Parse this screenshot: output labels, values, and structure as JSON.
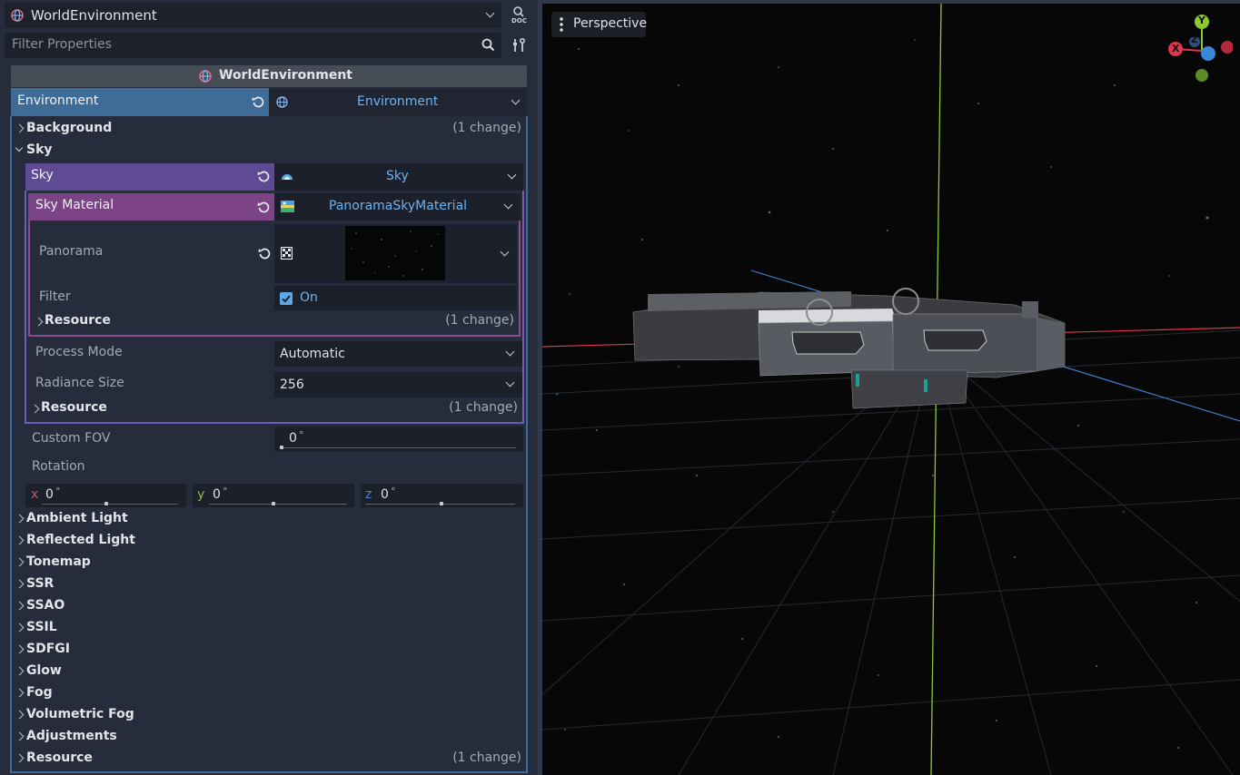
{
  "inspector": {
    "node_name": "WorldEnvironment",
    "filter_placeholder": "Filter Properties",
    "doc_label": "DOC",
    "section_title": "WorldEnvironment",
    "environment": {
      "label": "Environment",
      "resource": "Environment"
    },
    "groups_top": [
      {
        "label": "Background",
        "note": "(1 change)"
      }
    ],
    "sky_group": "Sky",
    "sky": {
      "label": "Sky",
      "resource": "Sky",
      "material_label": "Sky Material",
      "material_resource": "PanoramaSkyMaterial",
      "panorama_label": "Panorama",
      "filter_label": "Filter",
      "filter_value": "On",
      "mat_resource_label": "Resource",
      "mat_resource_note": "(1 change)",
      "process_mode_label": "Process Mode",
      "process_mode_value": "Automatic",
      "radiance_label": "Radiance Size",
      "radiance_value": "256",
      "sky_resource_label": "Resource",
      "sky_resource_note": "(1 change)"
    },
    "custom_fov": {
      "label": "Custom FOV",
      "value": "0",
      "unit": "°"
    },
    "rotation": {
      "label": "Rotation",
      "x": {
        "axis": "x",
        "value": "0",
        "unit": "°"
      },
      "y": {
        "axis": "y",
        "value": "0",
        "unit": "°"
      },
      "z": {
        "axis": "z",
        "value": "0",
        "unit": "°"
      }
    },
    "groups_bottom": [
      {
        "label": "Ambient Light",
        "note": ""
      },
      {
        "label": "Reflected Light",
        "note": ""
      },
      {
        "label": "Tonemap",
        "note": ""
      },
      {
        "label": "SSR",
        "note": ""
      },
      {
        "label": "SSAO",
        "note": ""
      },
      {
        "label": "SSIL",
        "note": ""
      },
      {
        "label": "SDFGI",
        "note": ""
      },
      {
        "label": "Glow",
        "note": ""
      },
      {
        "label": "Fog",
        "note": ""
      },
      {
        "label": "Volumetric Fog",
        "note": ""
      },
      {
        "label": "Adjustments",
        "note": ""
      },
      {
        "label": "Resource",
        "note": "(1 change)"
      }
    ]
  },
  "viewport": {
    "view_label": "Perspective",
    "gizmo": {
      "x": "X",
      "y": "Y",
      "z": "Z"
    }
  },
  "colors": {
    "accent": "#5fa8e8",
    "environment_header": "#3f6b97",
    "sky_header": "#5e4b94",
    "material_header": "#7c4486",
    "axis_x": "#e0374f",
    "axis_y": "#8bc832",
    "axis_z": "#3a86d8"
  }
}
